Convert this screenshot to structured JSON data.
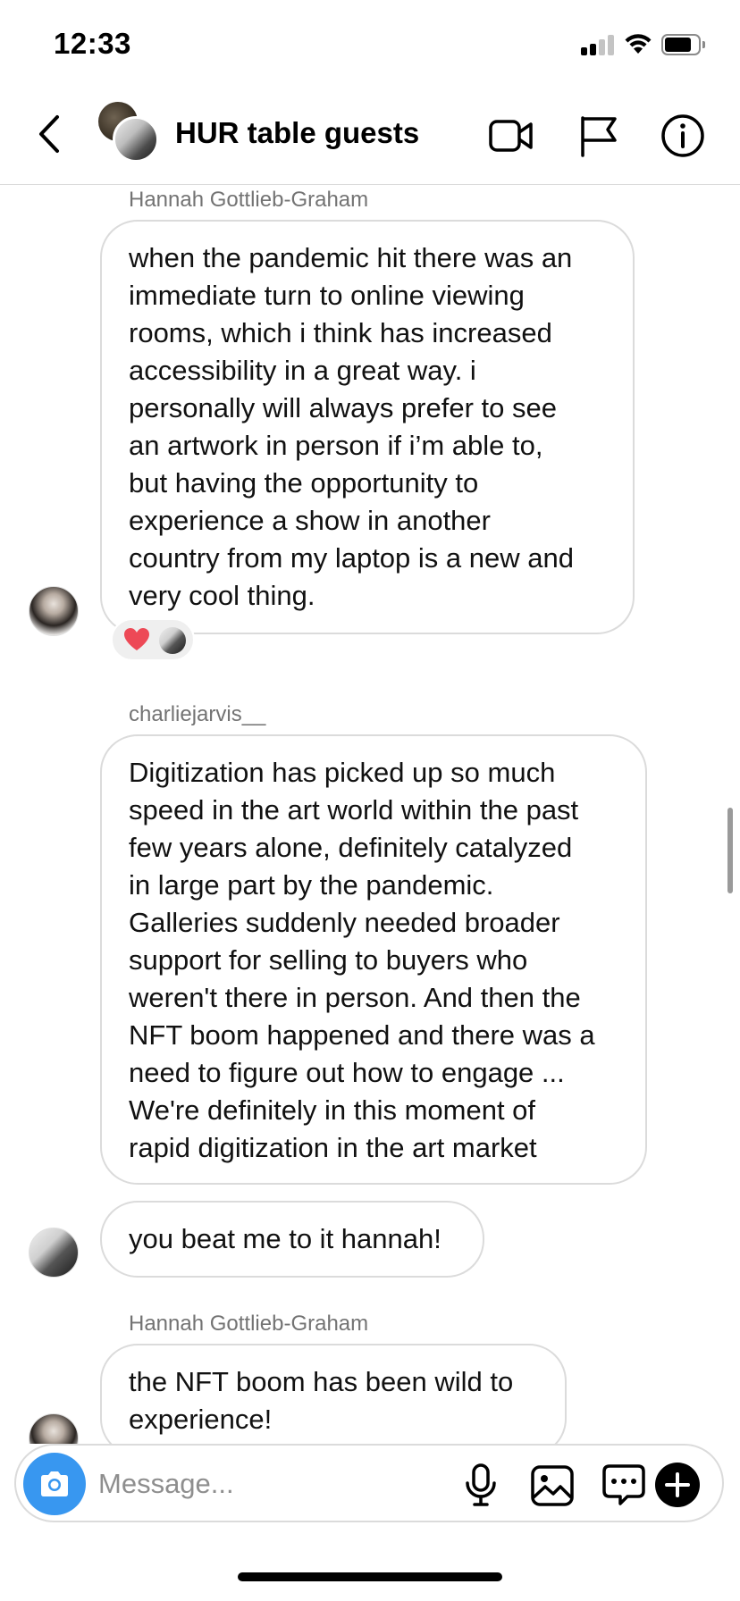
{
  "status_bar": {
    "time": "12:33",
    "signal_bars_active": 2,
    "signal_bars_total": 4,
    "battery_level": 0.7
  },
  "header": {
    "title": "HUR table guests",
    "icons": [
      "back-chevron-icon",
      "video-camera-icon",
      "flag-icon",
      "info-icon"
    ]
  },
  "messages": [
    {
      "sender": "Hannah Gottlieb-Graham",
      "text": "when the pandemic hit there was an immediate turn to online viewing rooms, which i think has increased accessibility in a great way. i personally will always prefer to see an artwork in person if i’m able to, but having the opportunity to experience a show in another country from my laptop is a new and very cool thing.",
      "lines": [
        "when the pandemic hit there was an",
        "immediate turn to online viewing",
        "rooms, which i think has increased",
        "accessibility in a great way. i",
        "personally will always prefer to see",
        "an artwork in person if i’m able to,",
        "but having the opportunity to",
        "experience a show in another",
        "country from my laptop is a new and",
        "very cool thing."
      ],
      "reactions": [
        "red-heart-emoji",
        "reactor-avatar"
      ]
    },
    {
      "sender": "charliejarvis__",
      "lines": [
        "Digitization has picked up so much",
        "speed in the art world within the past",
        "few years alone, definitely catalyzed",
        "in large part by the pandemic.",
        "Galleries suddenly needed broader",
        "support for selling to buyers who",
        "weren't there in person. And then the",
        "NFT boom happened and there was a",
        "need to figure out how to engage ...",
        "We're definitely in this moment of",
        "rapid digitization in the art market"
      ]
    },
    {
      "sender": "charliejarvis__",
      "lines": [
        "you beat me to it hannah!"
      ]
    },
    {
      "sender": "Hannah Gottlieb-Graham",
      "lines": [
        "the NFT boom has been wild to",
        "experience!"
      ]
    }
  ],
  "composer": {
    "placeholder": "Message...",
    "value": "",
    "icons": [
      "camera-icon",
      "microphone-icon",
      "gallery-icon",
      "sticker-chat-icon",
      "add-icon"
    ],
    "camera_color": "#3897f0"
  },
  "colors": {
    "bubble_border": "#dbdbdb",
    "secondary_text": "#737373",
    "heart": "#ed4956"
  }
}
